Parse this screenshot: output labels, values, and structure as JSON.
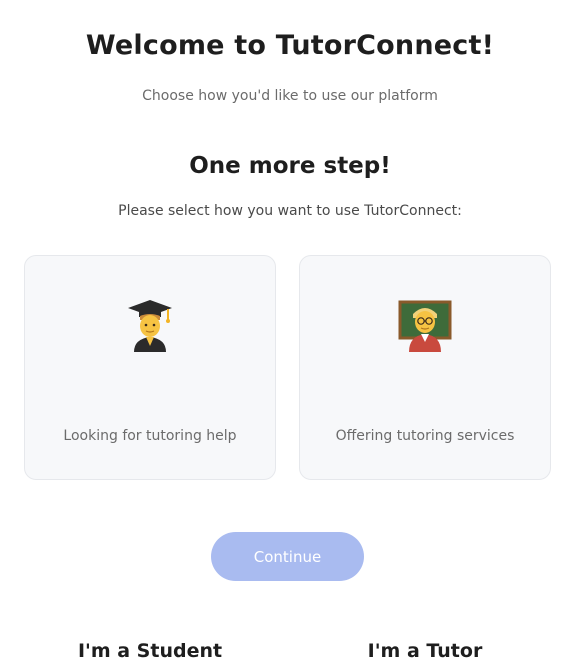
{
  "header": {
    "title": "Welcome to TutorConnect!",
    "subtitle": "Choose how you'd like to use our platform"
  },
  "step": {
    "title": "One more step!",
    "instruction": "Please select how you want to use TutorConnect:"
  },
  "options": [
    {
      "icon": "graduate-student-icon",
      "title": "I'm a Student",
      "description": "Looking for tutoring help"
    },
    {
      "icon": "teacher-icon",
      "title": "I'm a Tutor",
      "description": "Offering tutoring services"
    }
  ],
  "actions": {
    "continue_label": "Continue"
  },
  "colors": {
    "accent_disabled": "#a9bbf0",
    "card_background": "#f7f8fa",
    "card_border": "#e6e8ec"
  }
}
